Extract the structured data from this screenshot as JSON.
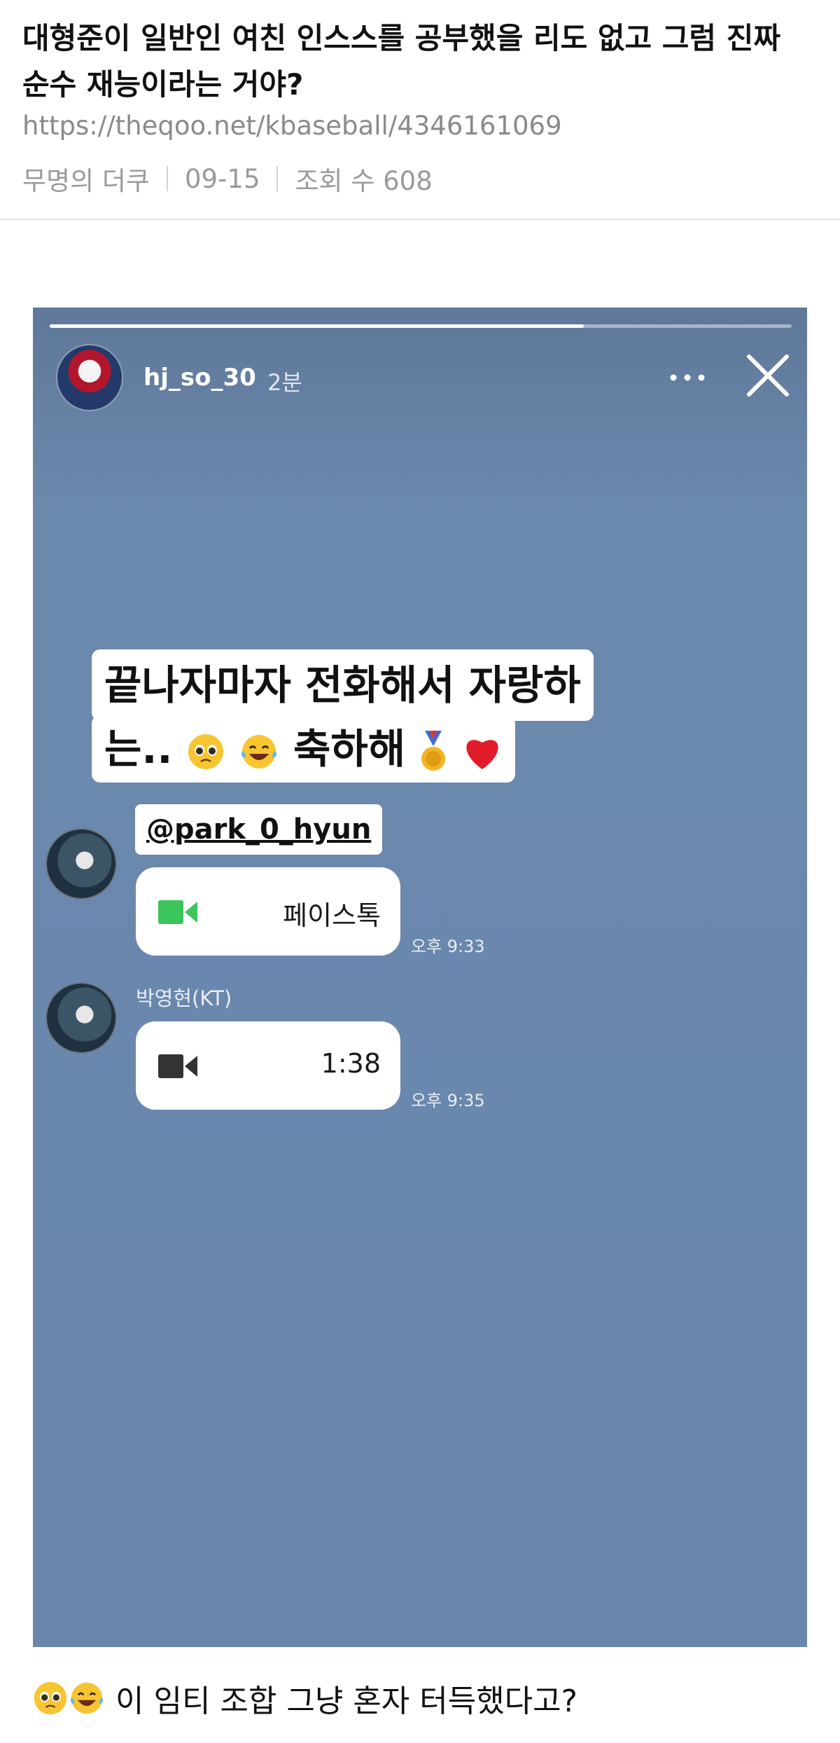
{
  "post": {
    "title": "대형준이 일반인 여친 인스스를 공부했을 리도 없고 그럼 진짜 순수 재능이라는 거야?",
    "url": "https://theqoo.net/kbaseball/4346161069",
    "author": "무명의 더쿠",
    "date": "09-15",
    "views": "조회 수 608"
  },
  "story": {
    "username": "hj_so_30",
    "time_ago": "2분",
    "progress": 0.72,
    "caption_line1": "끝나자마자 전화해서 자랑하",
    "caption_line2_prefix": "는..",
    "caption_line2_text": "축하해",
    "mention": "@park_0_hyun",
    "messages": [
      {
        "label": "페이스톡",
        "time": "오후 9:33",
        "icon": "video-camera-icon",
        "icon_color": "#3cc55a"
      },
      {
        "sender": "박영현(KT)",
        "label": "1:38",
        "time": "오후 9:35",
        "icon": "video-camera-icon",
        "icon_color": "#333333"
      }
    ]
  },
  "footer": {
    "text": "이 임티 조합 그냥 혼자 터득했다고?"
  },
  "icons": [
    "pleading-face-icon",
    "tears-of-joy-icon",
    "gold-medal-icon",
    "red-heart-icon",
    "more-icon",
    "close-icon"
  ]
}
